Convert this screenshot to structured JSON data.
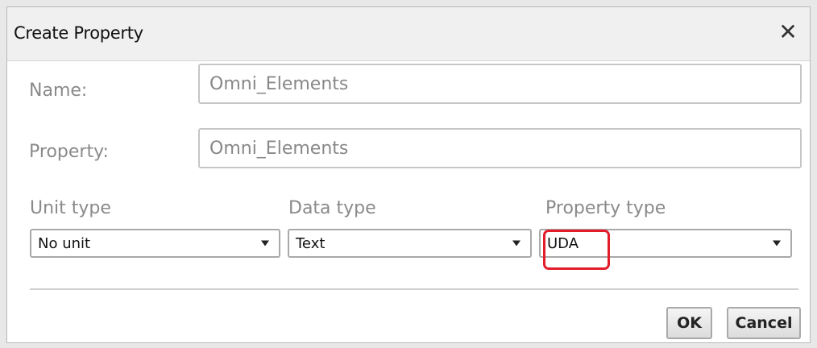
{
  "dialog": {
    "title": "Create Property",
    "close_icon": "close-icon"
  },
  "fields": {
    "name_label": "Name:",
    "name_value": "Omni_Elements",
    "property_label": "Property:",
    "property_value": "Omni_Elements"
  },
  "selects": {
    "unit_type_label": "Unit type",
    "unit_type_value": "No unit",
    "data_type_label": "Data type",
    "data_type_value": "Text",
    "property_type_label": "Property type",
    "property_type_value": "UDA"
  },
  "buttons": {
    "ok_label": "OK",
    "cancel_label": "Cancel"
  },
  "colors": {
    "highlight": "#e31c2a"
  }
}
